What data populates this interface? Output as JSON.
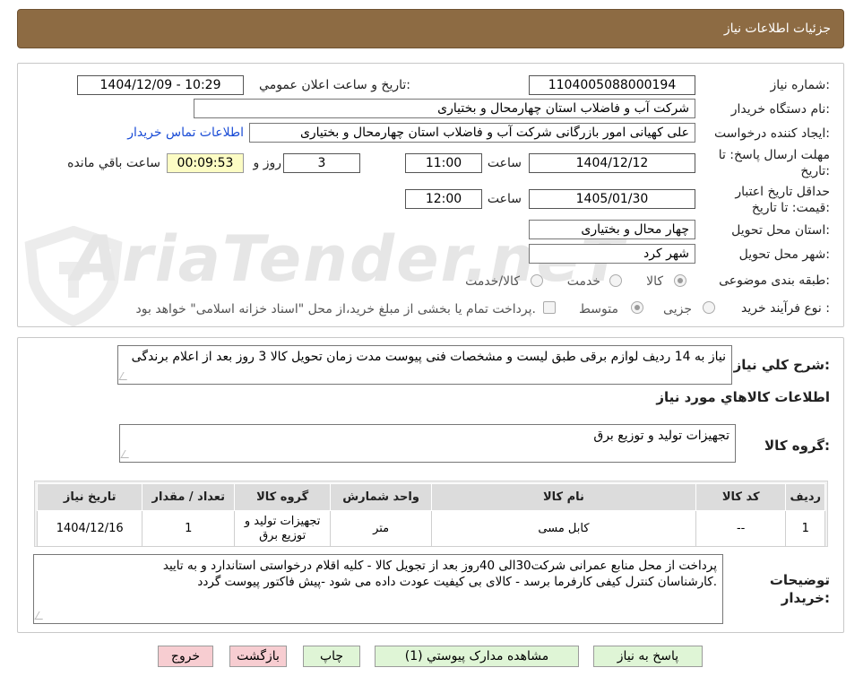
{
  "header": {
    "title": "جزئیات اطلاعات نیاز"
  },
  "watermark": {
    "text": "AriaTender.neT"
  },
  "form": {
    "need_number_label": "شماره نیاز:",
    "need_number": "1104005088000194",
    "announce_label": "تاریخ و ساعت اعلان عمومي:",
    "announce_value": "1404/12/09 - 10:29",
    "buyer_org_label": "نام دستگاه خریدار:",
    "buyer_org": "شرکت آب و فاضلاب استان چهارمحال و بختیاری",
    "requester_label": "ایجاد کننده درخواست:",
    "requester": "علی کهیانی امور بازرگانی شرکت آب و فاضلاب استان چهارمحال و بختیاری",
    "contact_link": "اطلاعات تماس خریدار",
    "deadline_label_1": "مهلت ارسال پاسخ: تا",
    "deadline_label_2": "تاریخ:",
    "deadline_date": "1404/12/12",
    "time_label": "ساعت",
    "deadline_time": "11:00",
    "days_value": "3",
    "days_label": "روز و",
    "remaining_time": "00:09:53",
    "remaining_label": "ساعت باقي مانده",
    "validity_label_1": "حداقل تاریخ اعتبار",
    "validity_label_2": "قیمت: تا تاریخ:",
    "validity_date": "1405/01/30",
    "validity_time_label": "ساعت",
    "validity_time": "12:00",
    "province_label": "استان محل تحویل:",
    "province": "چهار محال و بختیاری",
    "city_label": "شهر محل تحویل:",
    "city": "شهر کرد",
    "category_label": "طبقه بندی موضوعی:",
    "category_options": [
      "کالا",
      "خدمت",
      "کالا/خدمت"
    ],
    "process_label": "نوع فرآیند خرید :",
    "process_options": [
      "جزیی",
      "متوسط"
    ],
    "treasury_note": "پرداخت تمام یا بخشی از مبلغ خرید،از محل \"اسناد خزانه اسلامی\" خواهد بود."
  },
  "details": {
    "summary_label": "شرح کلي نياز:",
    "summary_text": "نیاز به 14 ردیف لوازم برقی طبق لیست و مشخصات فنی پیوست مدت زمان تحویل کالا 3 روز بعد از اعلام برندگی",
    "goods_info_title": "اطلاعات کالاهاي مورد نياز",
    "goods_group_label": "گروه کالا:",
    "goods_group_value": "تجهیزات تولید و توزیع برق",
    "table": {
      "headers": [
        "ردیف",
        "کد کالا",
        "نام کالا",
        "واحد شمارش",
        "گروه کالا",
        "تعداد / مقدار",
        "تاریخ نیاز"
      ],
      "rows": [
        [
          "1",
          "--",
          "کابل مسی",
          "متر",
          "تجهیزات تولید و توزیع برق",
          "1",
          "1404/12/16"
        ]
      ]
    },
    "buyer_notes_label_1": "توضیحات",
    "buyer_notes_label_2": "خریدار:",
    "buyer_notes_line1": "پرداخت از محل منابع عمرانی شرکت30الی 40روز بعد از تجویل کالا    - کلیه اقلام درخواستی استاندارد و به تایید",
    "buyer_notes_line2": "کارشناسان کنترل کیفی کارفرما برسد - کالای بی کیفیت عودت داده می شود -پیش فاکتور پیوست گردد."
  },
  "buttons": {
    "reply": "پاسخ به نیاز",
    "attachments": "مشاهده مدارک پیوستي (1)",
    "print": "چاپ",
    "back": "بازگشت",
    "exit": "خروج"
  },
  "colors": {
    "header_bg": "#8d6b43",
    "green_btn": "#dff5d6",
    "pink_btn": "#f7cdd1",
    "timer_bg": "#fcfcc4",
    "link": "#1a4cd6"
  }
}
